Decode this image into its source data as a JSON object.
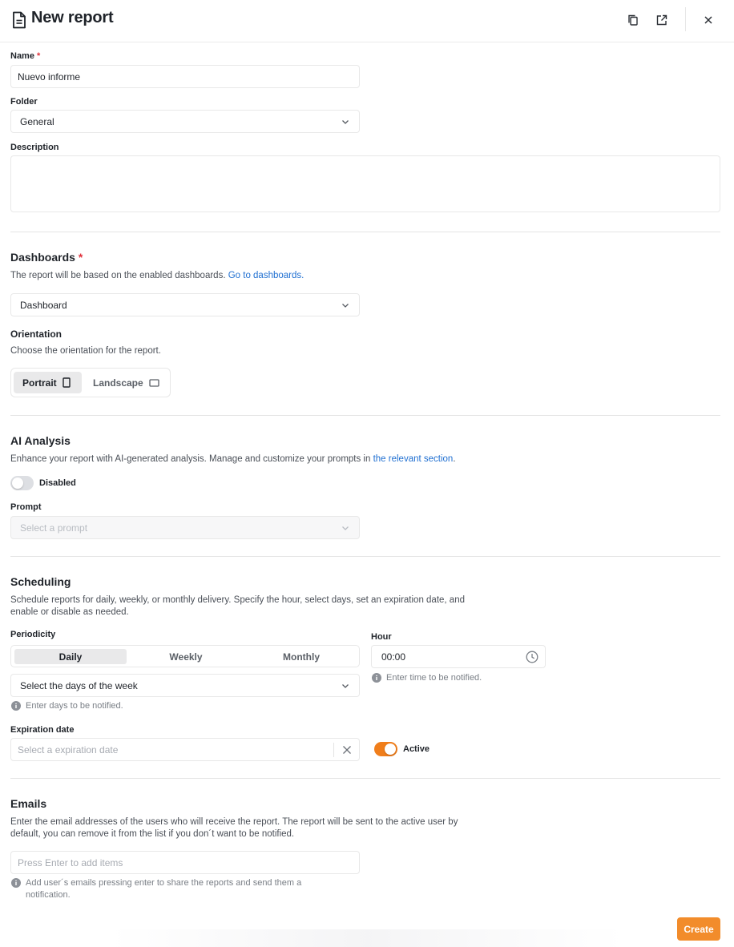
{
  "header": {
    "title": "New report",
    "icons": [
      "document-icon",
      "copy-icon",
      "open-external-icon",
      "close-icon"
    ]
  },
  "form": {
    "name": {
      "label": "Name",
      "required_mark": "*",
      "value": "Nuevo informe"
    },
    "folder": {
      "label": "Folder",
      "value": "General"
    },
    "description": {
      "label": "Description",
      "value": ""
    }
  },
  "dashboards": {
    "title": "Dashboards",
    "required_mark": "*",
    "description": "The report will be based on the enabled dashboards.",
    "link": "Go to dashboards.",
    "value": "Dashboard"
  },
  "orientation": {
    "title": "Orientation",
    "description": "Choose the orientation for the report.",
    "options": [
      {
        "label": "Portrait",
        "icon": "portrait-icon",
        "active": true
      },
      {
        "label": "Landscape",
        "icon": "landscape-icon",
        "active": false
      }
    ]
  },
  "ai_analysis": {
    "title": "AI Analysis",
    "description": "Enhance your report with AI-generated analysis. Manage and customize your prompts in",
    "link": "the relevant section",
    "link_suffix": ".",
    "toggle_label": "Disabled",
    "toggle_on": false,
    "prompt_label": "Prompt",
    "prompt_placeholder": "Select a prompt"
  },
  "scheduling": {
    "title": "Scheduling",
    "description_line1": "Schedule reports for daily, weekly, or monthly delivery. Specify the hour, select days, set an expiration date, and",
    "description_line2": "enable or disable as needed.",
    "periodicity_label": "Periodicity",
    "periodicity_options": [
      {
        "label": "Daily",
        "active": true
      },
      {
        "label": "Weekly",
        "active": false
      },
      {
        "label": "Monthly",
        "active": false
      }
    ],
    "days_placeholder": "Select the days of the week",
    "days_hint": "Enter days to be notified.",
    "hour_label": "Hour",
    "hour_value": "00:00",
    "hour_hint": "Enter time to be notified.",
    "expiration_label": "Expiration date",
    "expiration_placeholder": "Select a expiration date",
    "active_label": "Active",
    "active_on": true
  },
  "emails": {
    "title": "Emails",
    "description_line1": "Enter the email addresses of the users who will receive the report. The report will be sent to the active user by",
    "description_line2": "default, you can remove it from the list if you don´t want to be notified.",
    "placeholder": "Press Enter to add items",
    "hint_line1": "Add user´s emails pressing enter to share the reports and send them a",
    "hint_line2": "notification."
  },
  "footer": {
    "create_label": "Create"
  },
  "colors": {
    "accent": "#f28c2b",
    "toggle_on": "#f07e1b",
    "link": "#1f6fd1",
    "required": "#e0323c"
  }
}
